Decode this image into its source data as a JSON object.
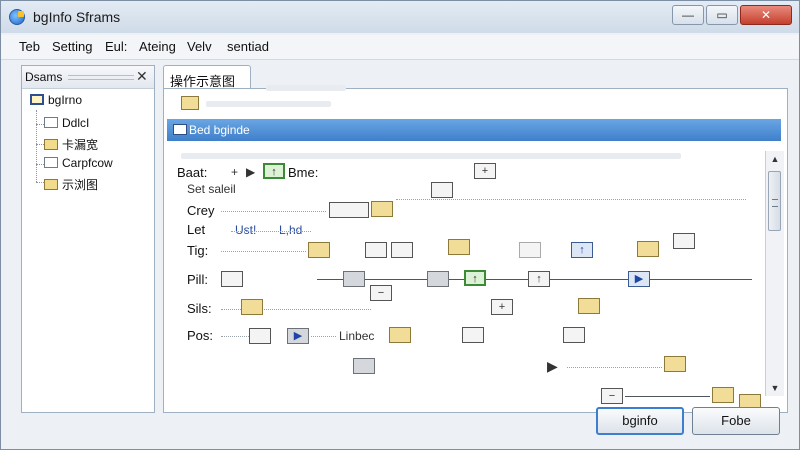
{
  "window": {
    "title": "bgInfo Sframs",
    "buttons": {
      "minimize": "—",
      "maximize": "▭",
      "close": "✕"
    }
  },
  "menubar": {
    "items": [
      "Teb",
      "Setting",
      "Eul:",
      "Ateing",
      "Velv",
      "sentiad"
    ]
  },
  "sidebar": {
    "header": "Dsams",
    "close_glyph": "✕",
    "items": [
      {
        "label": "bgIrno",
        "icon": "folder-blue-icon"
      },
      {
        "label": "DdlcI",
        "icon": "folder-icon"
      },
      {
        "label": "卡漏宽",
        "icon": "folder-icon"
      },
      {
        "label": "Carpfcow",
        "icon": "folder-icon"
      },
      {
        "label": "示浏图",
        "icon": "folder-arrow-icon"
      }
    ]
  },
  "main": {
    "tab_label": "操作示意图",
    "selected_row": "Bed bginde",
    "diagram": {
      "top_label": "Baat:",
      "top_label_right": "Bme:",
      "set_label": "Set saleil",
      "rows": [
        "Crey",
        "Let",
        "Tig:",
        "Pill:",
        "Sils:",
        "Pos:"
      ],
      "let_sublabel": "Ust!",
      "let_sublabel_right": "L,hd",
      "pos_inline_label": "Linbec",
      "plus_glyph": "+",
      "play_glyph": "▶",
      "arrow_glyph": "▶",
      "minus_glyph": "−",
      "up_glyph": "↑"
    }
  },
  "footer": {
    "primary_button": "bginfo",
    "secondary_button": "Fobe"
  },
  "colors": {
    "selection": "#3f7fcb",
    "accent": "#3c7fd1",
    "node_yellow": "#f2dd98"
  }
}
